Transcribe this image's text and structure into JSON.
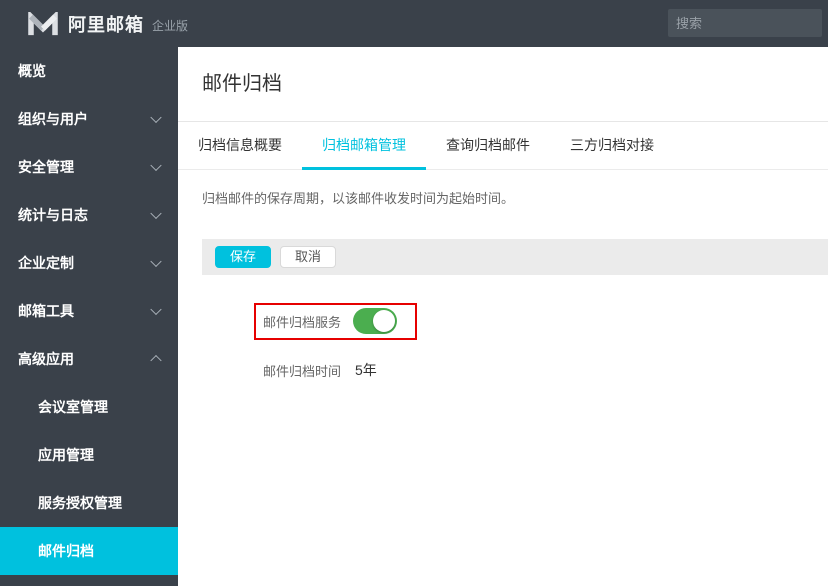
{
  "topbar": {
    "brand": "阿里邮箱",
    "brand_suffix": "企业版",
    "search_placeholder": "搜索"
  },
  "sidebar": {
    "items": [
      {
        "label": "概览",
        "level": 1,
        "chevron": null,
        "active": false
      },
      {
        "label": "组织与用户",
        "level": 1,
        "chevron": "down",
        "active": false
      },
      {
        "label": "安全管理",
        "level": 1,
        "chevron": "down",
        "active": false
      },
      {
        "label": "统计与日志",
        "level": 1,
        "chevron": "down",
        "active": false
      },
      {
        "label": "企业定制",
        "level": 1,
        "chevron": "down",
        "active": false
      },
      {
        "label": "邮箱工具",
        "level": 1,
        "chevron": "down",
        "active": false
      },
      {
        "label": "高级应用",
        "level": 1,
        "chevron": "up",
        "active": false
      },
      {
        "label": "会议室管理",
        "level": 2,
        "chevron": null,
        "active": false
      },
      {
        "label": "应用管理",
        "level": 2,
        "chevron": null,
        "active": false
      },
      {
        "label": "服务授权管理",
        "level": 2,
        "chevron": null,
        "active": false
      },
      {
        "label": "邮件归档",
        "level": 2,
        "chevron": null,
        "active": true
      }
    ]
  },
  "main": {
    "title": "邮件归档",
    "tabs": [
      {
        "label": "归档信息概要",
        "active": false
      },
      {
        "label": "归档邮箱管理",
        "active": true
      },
      {
        "label": "查询归档邮件",
        "active": false
      },
      {
        "label": "三方归档对接",
        "active": false
      }
    ],
    "description": "归档邮件的保存周期，以该邮件收发时间为起始时间。",
    "toolbar": {
      "save_label": "保存",
      "cancel_label": "取消"
    },
    "form": {
      "service_label": "邮件归档服务",
      "service_enabled": true,
      "time_label": "邮件归档时间",
      "time_value": "5年"
    }
  },
  "colors": {
    "accent": "#00c1de",
    "dark_chrome": "#3a414a",
    "toggle_on": "#4bae4f",
    "annotation_red": "#e60000",
    "toolbar_gray": "#ebebeb"
  }
}
